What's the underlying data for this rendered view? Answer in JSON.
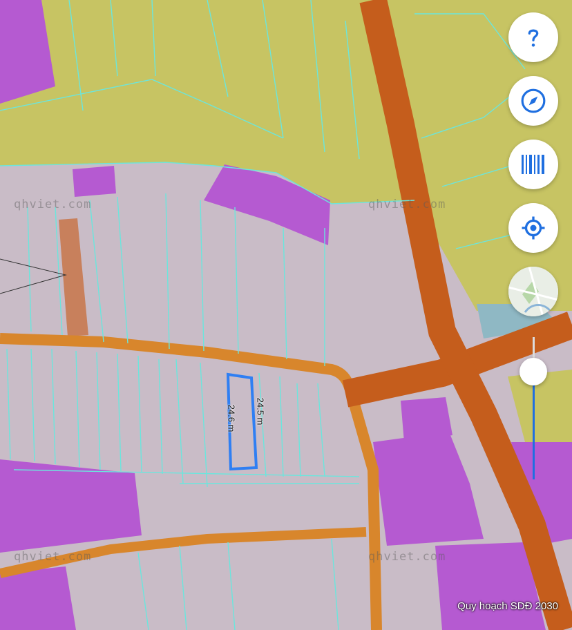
{
  "map": {
    "watermark": "qhviet.com",
    "layer_label": "Quy hoạch SDĐ 2030",
    "measurements": {
      "side_a": "24.5 m",
      "side_b": "24.6 m"
    },
    "zoom_level": 0.75
  },
  "controls": {
    "help_icon": "question-mark-icon",
    "compass_icon": "compass-icon",
    "layers_icon": "barcode-icon",
    "locate_icon": "locate-icon",
    "basemap_icon": "map-thumbnail-icon"
  },
  "colors": {
    "agri": "#c7c463",
    "residential": "#c99bc7",
    "magenta": "#b55ad1",
    "road": "#d8862c",
    "highway": "#c55d1c",
    "parcel": "#6be6dd",
    "selection": "#2f7ff3",
    "accent": "#1f6fe0"
  }
}
